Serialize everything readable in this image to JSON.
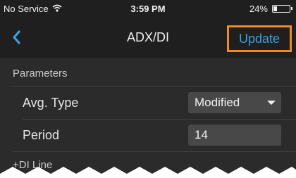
{
  "status_bar": {
    "carrier": "No Service",
    "time": "3:59 PM",
    "battery": "24%",
    "battery_level": 0.24
  },
  "nav": {
    "title": "ADX/DI",
    "action_label": "Update",
    "highlight_color": "#f08a24",
    "action_color": "#3aa0e0"
  },
  "sections": {
    "parameters_title": "Parameters",
    "avg_type_label": "Avg. Type",
    "avg_type_value": "Modified",
    "period_label": "Period",
    "period_value": "14",
    "di_line_title": "+DI Line"
  }
}
